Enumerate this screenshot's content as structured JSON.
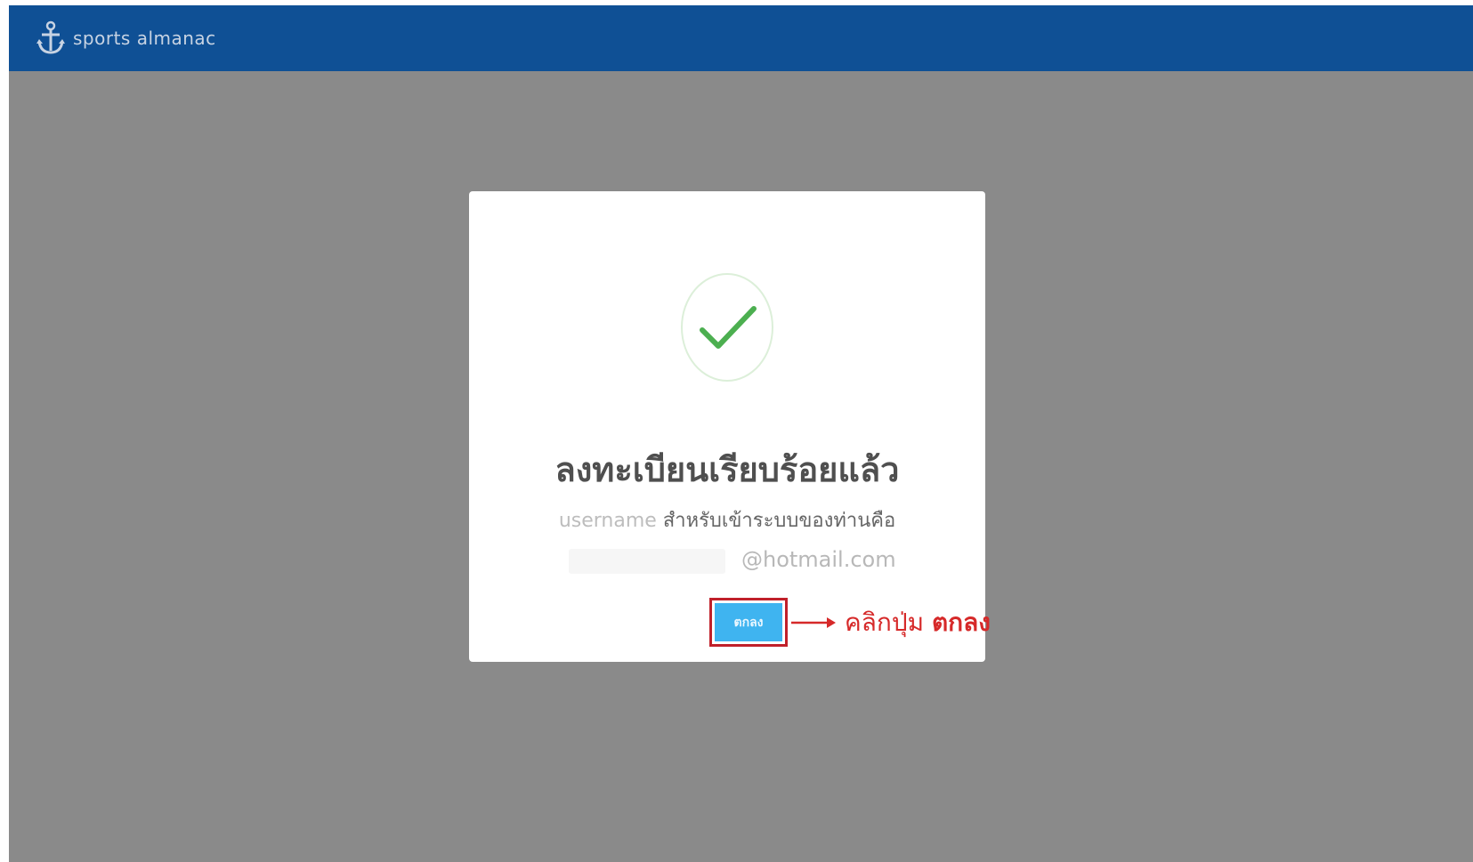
{
  "header": {
    "brand": "sports almanac",
    "logo_icon": "anchor-icon",
    "bg_color": "#0f5095"
  },
  "modal": {
    "icon": "check-icon",
    "title": "ลงทะเบียนเรียบร้อยแล้ว",
    "username_label": "username",
    "message": "สำหรับเข้าระบบของท่านคือ",
    "email_domain": "@hotmail.com",
    "ok_label": "ตกลง",
    "ok_color": "#3fb4f0"
  },
  "annotation": {
    "text_prefix": "คลิกปุ่ม",
    "text_button": "ตกลง",
    "color": "#d62929"
  }
}
